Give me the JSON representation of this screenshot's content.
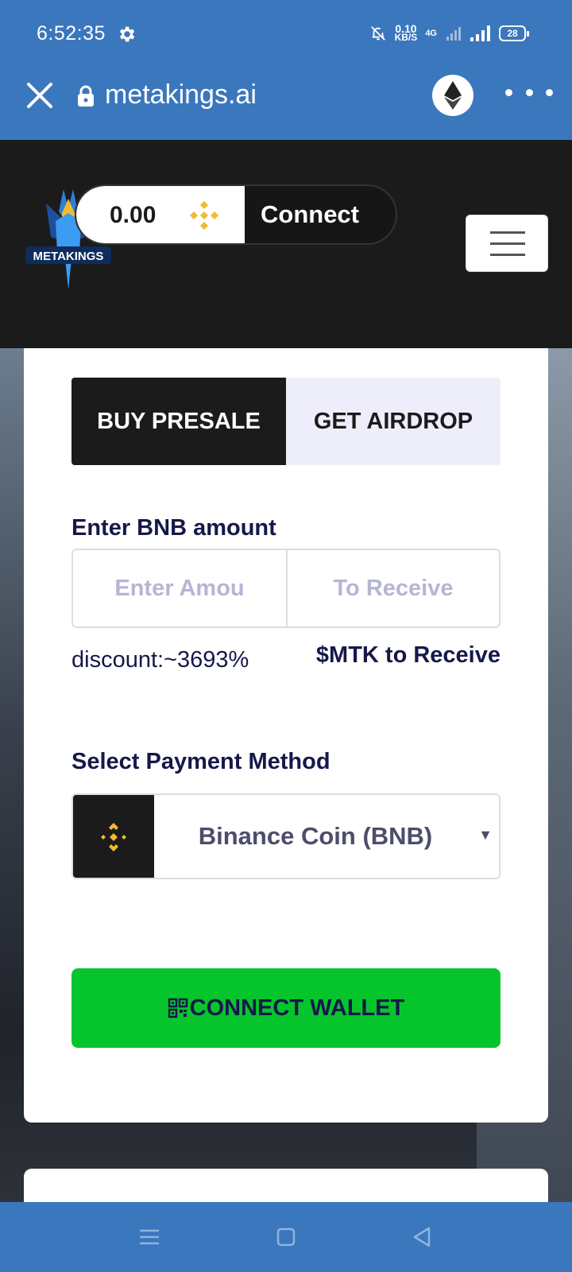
{
  "status_bar": {
    "time": "6:52:35",
    "net_speed_value": "0.10",
    "net_speed_unit": "KB/S",
    "network_type": "4G",
    "battery": "28"
  },
  "browser": {
    "url": "metakings.ai",
    "icons": [
      "close-icon",
      "lock-icon",
      "ethereum-icon",
      "more-icon"
    ]
  },
  "header": {
    "logo_text": "METAKINGS",
    "balance": "0.00",
    "connect_label": "Connect"
  },
  "tabs": {
    "buy_presale": "BUY PRESALE",
    "get_airdrop": "GET AIRDROP"
  },
  "form": {
    "amount_label": "Enter BNB amount",
    "amount_placeholder": "Enter Amou",
    "receive_placeholder": "To Receive",
    "discount": "discount:~3693%",
    "mtk_receive": "$MTK to Receive",
    "payment_label": "Select Payment Method",
    "payment_selected": "Binance Coin (BNB)",
    "connect_wallet": "CONNECT WALLET"
  },
  "colors": {
    "browser_bar": "#3a77bd",
    "header_bg": "#1b1b1b",
    "accent_green": "#06c52c",
    "bnb_yellow": "#f3ba2f",
    "text_navy": "#16184a"
  }
}
